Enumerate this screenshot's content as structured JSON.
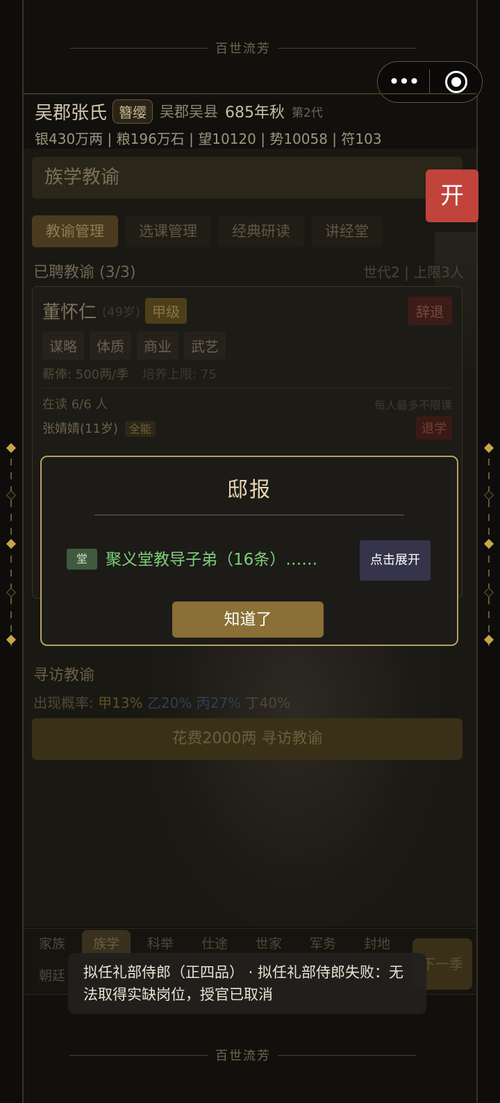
{
  "app": {
    "title": "百世流芳"
  },
  "capsule": {
    "more": "•••"
  },
  "header": {
    "clan": "吴郡张氏",
    "badge": "簪缨",
    "place": "吴郡吴县",
    "year": "685年秋",
    "generation": "第2代",
    "stats": "银430万两 | 粮196万石 | 望10120 | 势10058 | 符103"
  },
  "open_button": "开",
  "section": {
    "title": "族学教谕",
    "tabs": [
      "教谕管理",
      "选课管理",
      "经典研读",
      "讲经堂"
    ],
    "hired": "已聘教谕 (3/3)",
    "gen_limit": "世代2 | 上限3人"
  },
  "teacher": {
    "name": "董怀仁",
    "age": "(49岁)",
    "grade": "甲级",
    "dismiss": "辞退",
    "skills": [
      "谋略",
      "体质",
      "商业",
      "武艺"
    ],
    "salary": "薪俸: 500两/季",
    "train_cap": "培养上限: 75",
    "reading": "在读 6/6 人",
    "limit_note": "每人最多不限课",
    "student": "张婧婧(11岁)",
    "student_tag": "全能",
    "quit": "退学"
  },
  "search": {
    "title": "寻访教谕",
    "prob_label": "出现概率: ",
    "prob_a": "甲13%",
    "prob_b": "乙20%",
    "prob_c": "丙27%",
    "prob_d": "丁40%",
    "button": "花费2000两 寻访教谕"
  },
  "nav": {
    "row1": [
      "家族",
      "族学",
      "科举",
      "仕途",
      "世家",
      "军务",
      "封地"
    ],
    "row2_first": "朝廷",
    "next": "下一季"
  },
  "modal": {
    "title": "邸报",
    "tag": "堂",
    "text": "聚义堂教导子弟（16条）……",
    "expand": "点击展开",
    "ok": "知道了"
  },
  "toast": {
    "text": "拟任礼部侍郎（正四品） · 拟任礼部侍郎失败：无法取得实缺岗位，授官已取消"
  }
}
